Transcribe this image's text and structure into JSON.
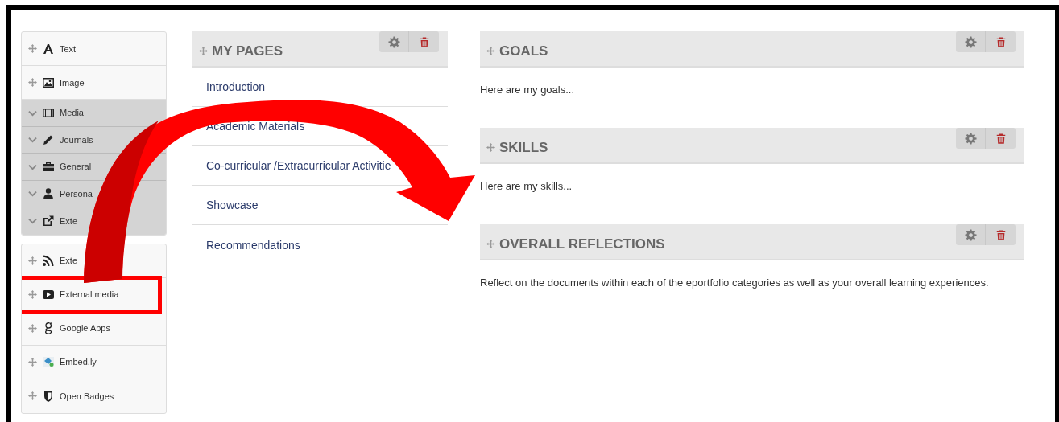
{
  "sidebar": {
    "groups": [
      {
        "items": [
          {
            "kind": "block",
            "label": "Text",
            "highlighted": false
          },
          {
            "kind": "block",
            "label": "Image",
            "highlighted": false
          },
          {
            "kind": "category",
            "label": "Media",
            "highlighted": false
          },
          {
            "kind": "category",
            "label": "Journals",
            "highlighted": false
          },
          {
            "kind": "category",
            "label": "General",
            "highlighted": false
          },
          {
            "kind": "category",
            "label": "Persona",
            "highlighted": false
          },
          {
            "kind": "category",
            "label": "Exte",
            "highlighted": false
          }
        ]
      },
      {
        "items": [
          {
            "kind": "block",
            "label": "Exte",
            "highlighted": false
          },
          {
            "kind": "block",
            "label": "External media",
            "highlighted": true
          },
          {
            "kind": "block",
            "label": "Google Apps",
            "highlighted": false
          },
          {
            "kind": "block",
            "label": "Embed.ly",
            "highlighted": false
          },
          {
            "kind": "block",
            "label": "Open Badges",
            "highlighted": false
          }
        ]
      }
    ]
  },
  "pages_block": {
    "title": "MY PAGES",
    "links": [
      "Introduction",
      "Academic Materials",
      "Co-curricular /Extracurricular Activitie",
      "Showcase",
      "Recommendations"
    ]
  },
  "blocks": [
    {
      "title": "GOALS",
      "body": "Here are my goals..."
    },
    {
      "title": "SKILLS",
      "body": "Here are my skills..."
    },
    {
      "title": "OVERALL REFLECTIONS",
      "body": "Reflect on the documents within each of the eportfolio categories as well as your overall learning experiences."
    }
  ]
}
